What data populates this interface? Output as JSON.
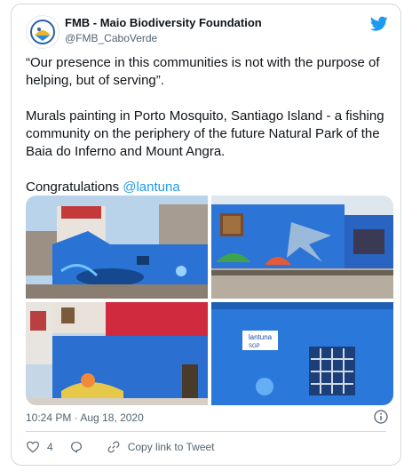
{
  "tweet": {
    "author_name": "FMB - Maio Biodiversity Foundation",
    "author_handle": "@FMB_CaboVerde",
    "paragraph_1": "“Our presence in this communities is not with the purpose of helping, but of serving”.",
    "paragraph_2": "Murals painting in Porto Mosquito, Santiago Island - a fishing community on the periphery of the future Natural Park of the Baia do Inferno and Mount Angra.",
    "congrats_text": "Congratulations ",
    "mention": "@lantuna",
    "timestamp": "10:24 PM · Aug 18, 2020",
    "like_count": "4",
    "copy_link_label": "Copy link to Tweet"
  },
  "photo_sign": {
    "brand": "lantuna",
    "sub": "SGP"
  },
  "colors": {
    "accent": "#1d9bf0",
    "twitter_blue": "#1d9bf0",
    "mural_blue": "#1f6fd1",
    "wall_red": "#d0283c"
  },
  "icons": [
    "twitter-bird-icon",
    "info-icon",
    "heart-icon",
    "reply-icon",
    "link-icon"
  ]
}
